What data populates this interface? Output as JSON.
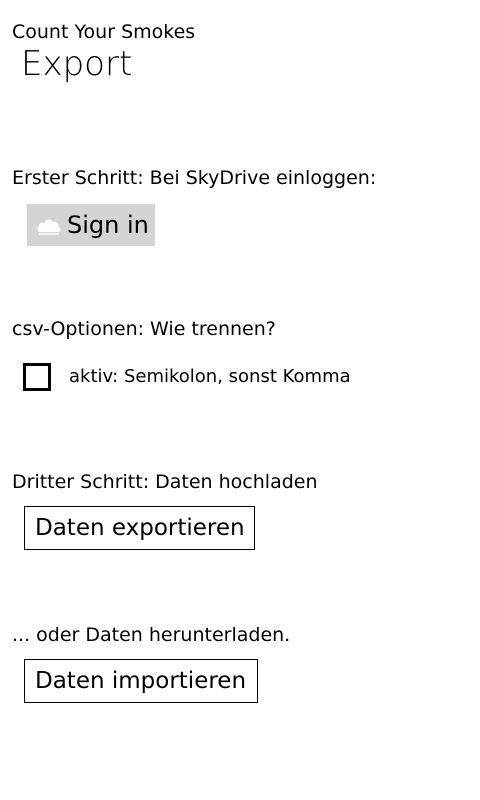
{
  "header": {
    "app_title": "Count Your Smokes",
    "page_title": "Export"
  },
  "step1": {
    "label": "Erster Schritt: Bei SkyDrive einloggen:",
    "signin_label": "Sign in",
    "signin_icon": "skydrive-cloud-icon"
  },
  "csv": {
    "label": "csv-Optionen: Wie trennen?",
    "checkbox_label": "aktiv: Semikolon, sonst Komma",
    "checked": false
  },
  "step3": {
    "label": "Dritter Schritt: Daten hochladen",
    "export_label": "Daten exportieren"
  },
  "download": {
    "label": "... oder Daten herunterladen.",
    "import_label": "Daten importieren"
  },
  "colors": {
    "background": "#ffffff",
    "text": "#000000",
    "signin_bg": "#d6d3d6"
  }
}
